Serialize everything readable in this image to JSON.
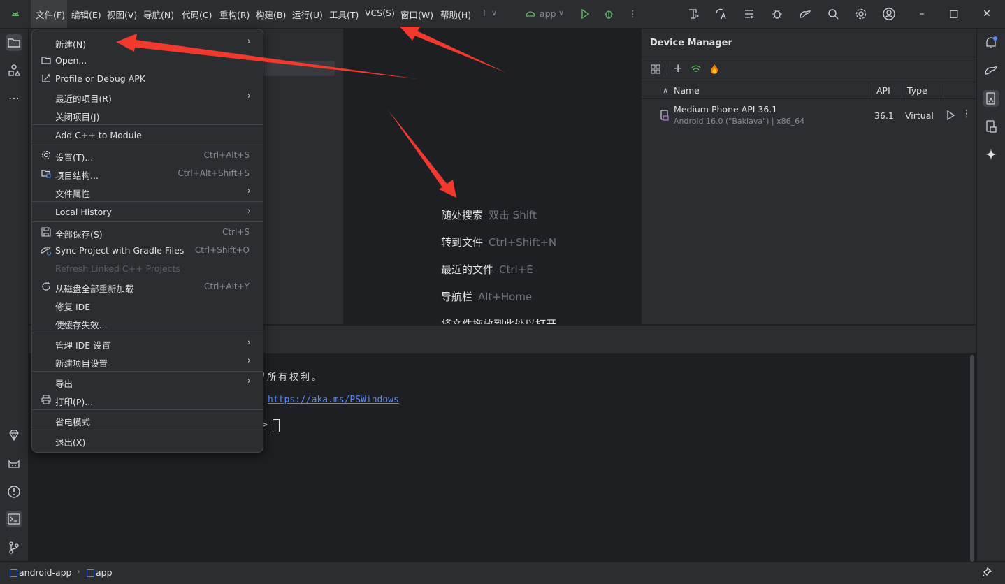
{
  "menubar": {
    "items": [
      "文件(F)",
      "编辑(E)",
      "视图(V)",
      "导航(N)",
      "代码(C)",
      "重构(R)",
      "构建(B)",
      "运行(U)",
      "工具(T)",
      "VCS(S)",
      "窗口(W)",
      "帮助(H)"
    ],
    "run_config": "app",
    "overflow_marker": "I"
  },
  "file_menu": {
    "items": [
      {
        "label": "新建(N)",
        "shortcut": "",
        "submenu": true,
        "icon": ""
      },
      {
        "label": "Open...",
        "shortcut": "",
        "submenu": false,
        "icon": "folder-icon"
      },
      {
        "label": "Profile or Debug APK",
        "shortcut": "",
        "submenu": false,
        "icon": "profile-apk-icon"
      },
      {
        "label": "最近的项目(R)",
        "shortcut": "",
        "submenu": true,
        "icon": ""
      },
      {
        "label": "关闭项目(J)",
        "shortcut": "",
        "submenu": false,
        "icon": ""
      },
      {
        "label": "Add C++ to Module",
        "shortcut": "",
        "submenu": false,
        "icon": ""
      },
      {
        "label": "设置(T)...",
        "shortcut": "Ctrl+Alt+S",
        "submenu": false,
        "icon": "gear-icon"
      },
      {
        "label": "项目结构...",
        "shortcut": "Ctrl+Alt+Shift+S",
        "submenu": false,
        "icon": "project-structure-icon"
      },
      {
        "label": "文件属性",
        "shortcut": "",
        "submenu": true,
        "icon": ""
      },
      {
        "label": "Local History",
        "shortcut": "",
        "submenu": true,
        "icon": ""
      },
      {
        "label": "全部保存(S)",
        "shortcut": "Ctrl+S",
        "submenu": false,
        "icon": "save-icon"
      },
      {
        "label": "Sync Project with Gradle Files",
        "shortcut": "Ctrl+Shift+O",
        "submenu": false,
        "icon": "gradle-sync-icon"
      },
      {
        "label": "Refresh Linked C++ Projects",
        "shortcut": "",
        "submenu": false,
        "icon": "",
        "disabled": true
      },
      {
        "label": "从磁盘全部重新加载",
        "shortcut": "Ctrl+Alt+Y",
        "submenu": false,
        "icon": "reload-icon"
      },
      {
        "label": "修复 IDE",
        "shortcut": "",
        "submenu": false,
        "icon": ""
      },
      {
        "label": "使缓存失效...",
        "shortcut": "",
        "submenu": false,
        "icon": ""
      },
      {
        "label": "管理 IDE 设置",
        "shortcut": "",
        "submenu": true,
        "icon": ""
      },
      {
        "label": "新建项目设置",
        "shortcut": "",
        "submenu": true,
        "icon": ""
      },
      {
        "label": "导出",
        "shortcut": "",
        "submenu": true,
        "icon": ""
      },
      {
        "label": "打印(P)...",
        "shortcut": "",
        "submenu": false,
        "icon": "print-icon"
      },
      {
        "label": "省电模式",
        "shortcut": "",
        "submenu": false,
        "icon": ""
      },
      {
        "label": "退出(X)",
        "shortcut": "",
        "submenu": false,
        "icon": ""
      }
    ]
  },
  "editor_hints": [
    {
      "action": "随处搜索",
      "shortcut": "双击 Shift"
    },
    {
      "action": "转到文件",
      "shortcut": "Ctrl+Shift+N"
    },
    {
      "action": "最近的文件",
      "shortcut": "Ctrl+E"
    },
    {
      "action": "导航栏",
      "shortcut": "Alt+Home"
    },
    {
      "action": "将文件拖放到此处以打开",
      "shortcut": ""
    }
  ],
  "device_manager": {
    "title": "Device Manager",
    "columns": {
      "name": "Name",
      "api": "API",
      "type": "Type"
    },
    "devices": [
      {
        "name": "Medium Phone API 36.1",
        "subtitle": "Android 16.0 (\"Baklava\") | x86_64",
        "api": "36.1",
        "type": "Virtual"
      }
    ]
  },
  "terminal": {
    "line1": "留所有权利。",
    "link": "https://aka.ms/PSWindows",
    "prompt": ">"
  },
  "statusbar": {
    "breadcrumb": [
      "android-app",
      "app"
    ]
  },
  "colors": {
    "background": "#1e1f22",
    "panel": "#2b2d30",
    "accent_green": "#5fb865",
    "link_blue": "#548af7",
    "annotation_red": "#f03a2e"
  }
}
